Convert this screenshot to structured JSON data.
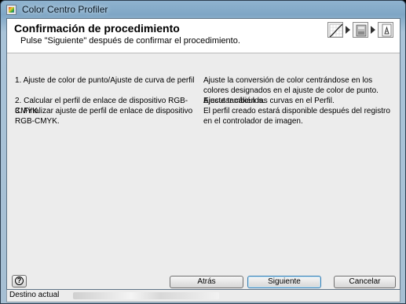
{
  "window": {
    "title": "Color Centro Profiler"
  },
  "header": {
    "title": "Confirmación de procedimiento",
    "subtitle": "Pulse \"Siguiente\" después de confirmar el procedimiento.",
    "step_icons": [
      "curve-adjust-icon",
      "printer-icon",
      "profile-document-icon"
    ]
  },
  "procedure": [
    {
      "step": "1. Ajuste de color de punto/Ajuste de curva de perfil",
      "description": "Ajuste la conversión de color centrándose en los colores designados en el ajuste de color de punto. Ajuste también las curvas en el Perfil."
    },
    {
      "step": "2. Calcular el perfil de enlace de dispositivo RGB-CMYK",
      "description": "Ejecutar cálculos."
    },
    {
      "step": "3. Finalizar ajuste de perfil de enlace de dispositivo RGB-CMYK.",
      "description": "El perfil creado estará disponible después del registro en el controlador de imagen."
    }
  ],
  "footer": {
    "help_label": "?",
    "back_label": "Atrás",
    "next_label": "Siguiente",
    "cancel_label": "Cancelar"
  },
  "status": {
    "label": "Destino actual"
  }
}
